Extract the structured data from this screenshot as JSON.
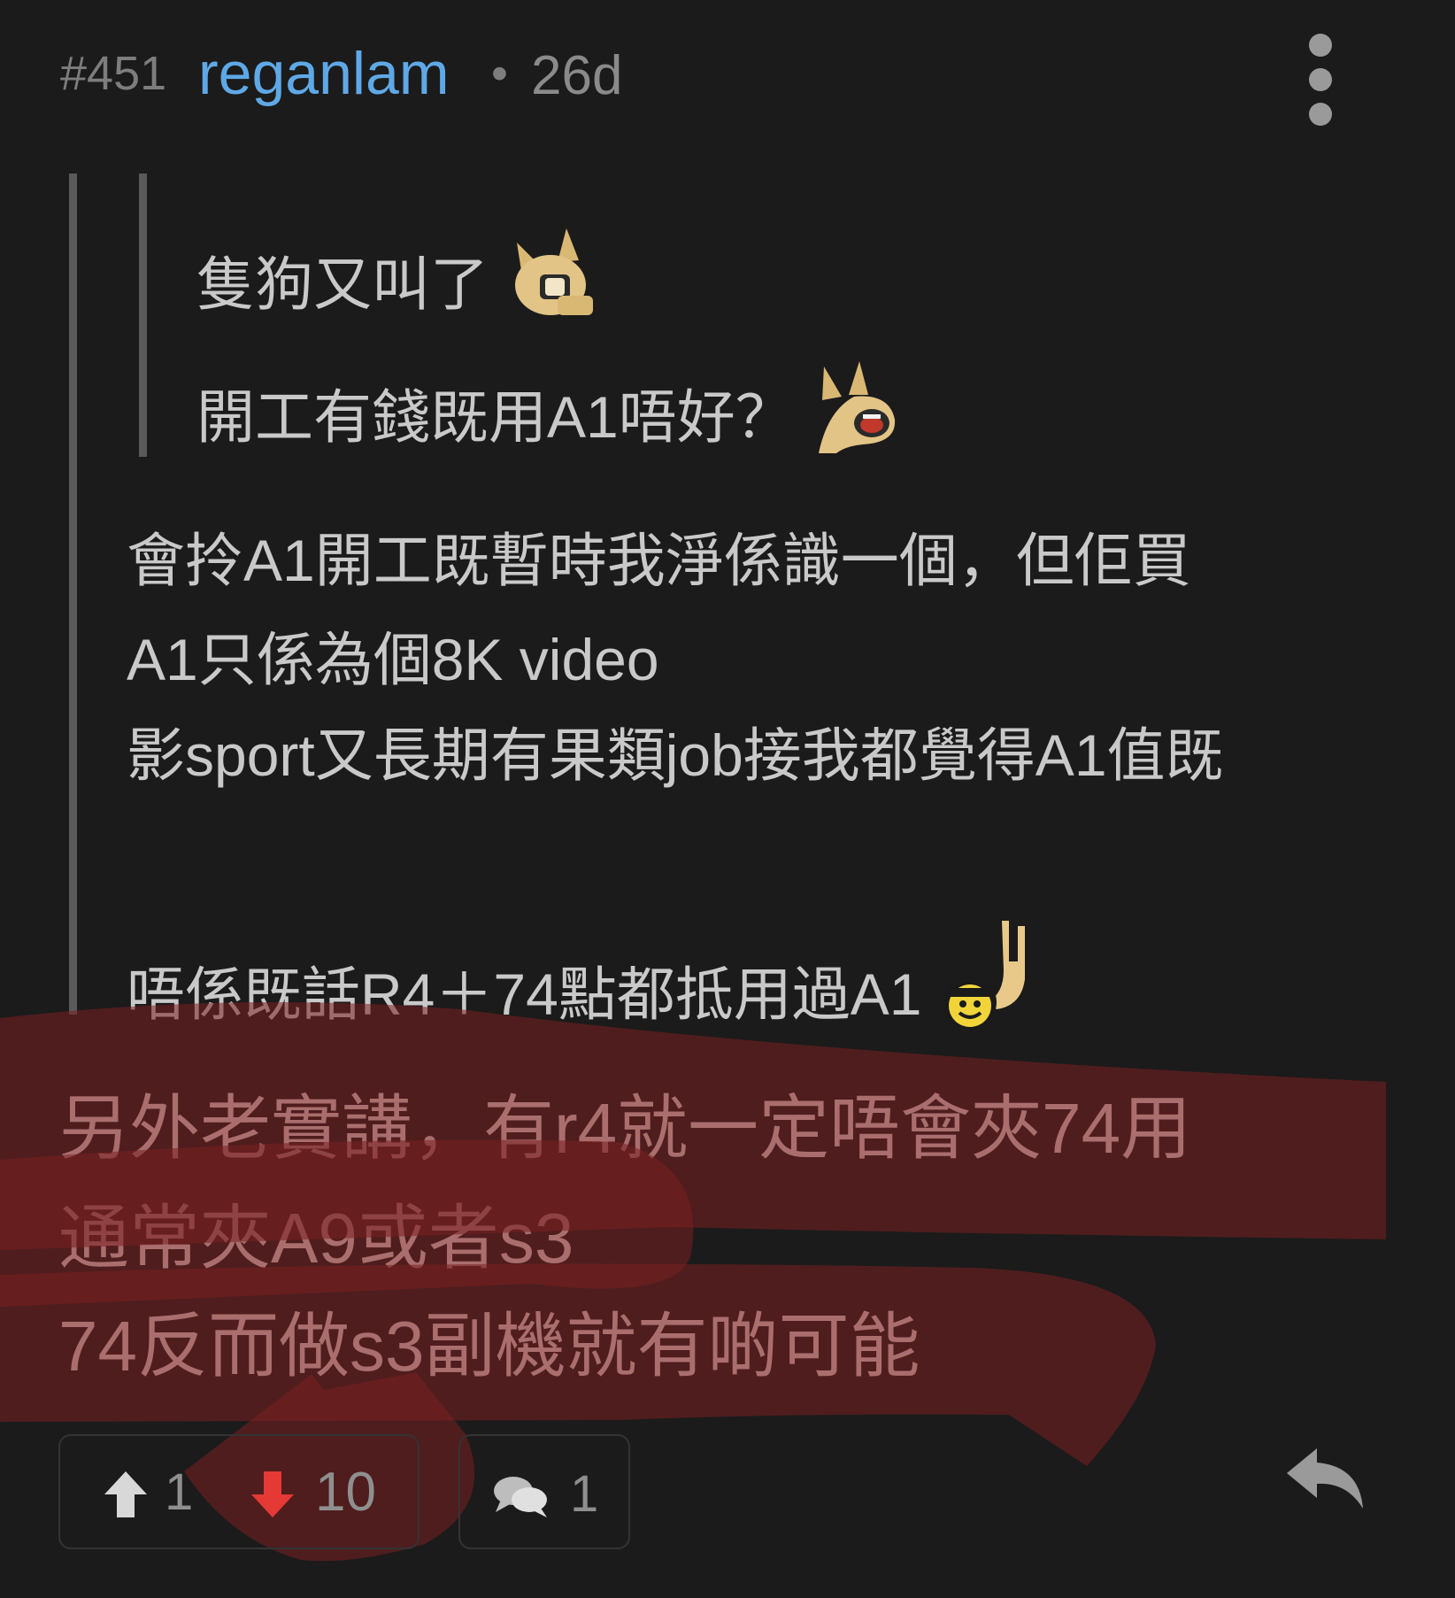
{
  "header": {
    "post_number": "#451",
    "username": "reganlam",
    "separator": "•",
    "age": "26d",
    "more_icon": "more-vertical-icon"
  },
  "quote_nested": {
    "line1": "隻狗又叫了",
    "line2": "開工有錢既用A1唔好？"
  },
  "quote_outer": {
    "line1": "會拎A1開工既暫時我淨係識一個，但佢買",
    "line2": "A1只係為個8K video",
    "line3": "影sport又長期有果類job接我都覺得A1值既",
    "line4": "唔係既話R4＋74點都抵用過A1"
  },
  "reply": {
    "line1": "另外老實講，有r4就一定唔會夾74用",
    "line2": "通常夾A9或者s3",
    "line3": "74反而做s3副機就有啲可能"
  },
  "footer": {
    "upvote_count": "1",
    "downvote_count": "10",
    "comment_count": "1",
    "upvote_color": "#d8d8d8",
    "downvote_color": "#e53935"
  }
}
